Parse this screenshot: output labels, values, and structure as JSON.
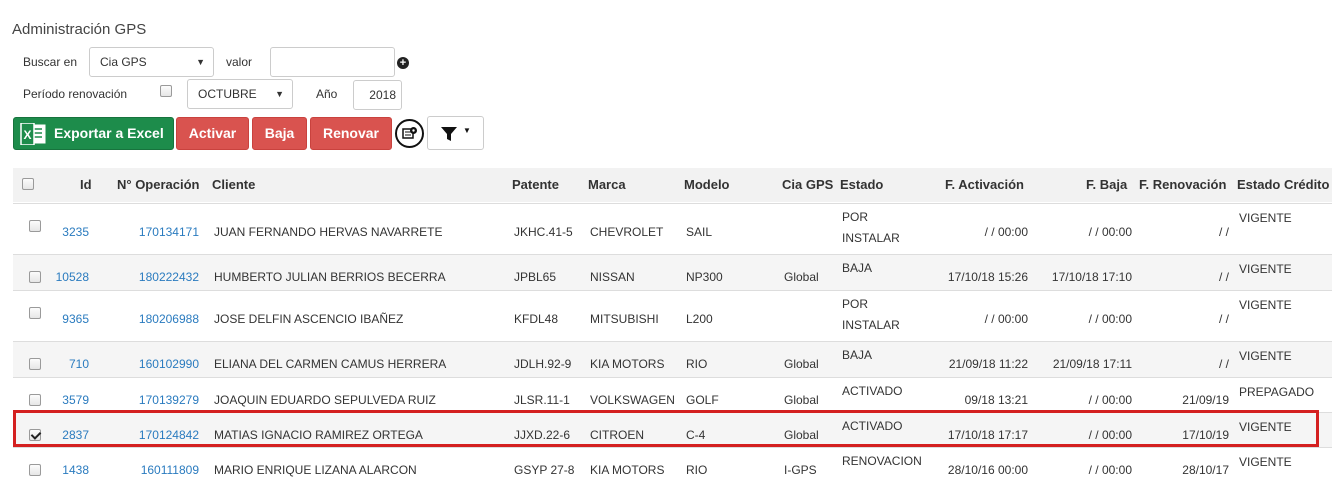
{
  "page": {
    "title": "Administración GPS",
    "search_label": "Buscar en",
    "search_select": "Cia GPS",
    "value_label": "valor",
    "value_input": "",
    "period_label": "Período renovación",
    "month_select": "OCTUBRE",
    "year_label": "Año",
    "year_value": "2018"
  },
  "toolbar": {
    "export_label": "Exportar a Excel",
    "activar_label": "Activar",
    "baja_label": "Baja",
    "renovar_label": "Renovar",
    "icons": [
      "excel-icon",
      "settings-icon",
      "filter-icon",
      "caret-down-icon",
      "plus-circle-icon"
    ]
  },
  "colors": {
    "excel": "#1d8c4b",
    "danger": "#d9534f",
    "link": "#2a7bbf",
    "highlight": "#d42020"
  },
  "table": {
    "headers": {
      "id": "Id",
      "op": "N° Operación",
      "cliente": "Cliente",
      "patente": "Patente",
      "marca": "Marca",
      "modelo": "Modelo",
      "cia": "Cia GPS",
      "estado": "Estado",
      "f_act": "F. Activación",
      "f_baja": "F. Baja",
      "f_ren": "F. Renovación",
      "credito": "Estado Crédito"
    },
    "rows": [
      {
        "id": "3235",
        "op": "170134171",
        "cliente": "JUAN FERNANDO HERVAS NAVARRETE",
        "patente": "JKHC.41-5",
        "marca": "CHEVROLET",
        "modelo": "SAIL",
        "cia": "",
        "estado1": "POR",
        "estado2": "INSTALAR",
        "f_act": " /  / 00:00",
        "f_baja": " /  / 00:00",
        "f_ren": " /  / ",
        "credito": "VIGENTE",
        "checked": false
      },
      {
        "id": "10528",
        "op": "180222432",
        "cliente": "HUMBERTO JULIAN BERRIOS BECERRA",
        "patente": "JPBL65",
        "marca": "NISSAN",
        "modelo": "NP300",
        "cia": "Global",
        "estado1": "BAJA",
        "estado2": "",
        "f_act": "17/10/18 15:26",
        "f_baja": "17/10/18 17:10",
        "f_ren": " /  / ",
        "credito": "VIGENTE",
        "checked": false
      },
      {
        "id": "9365",
        "op": "180206988",
        "cliente": "JOSE DELFIN ASCENCIO IBAÑEZ",
        "patente": "KFDL48",
        "marca": "MITSUBISHI",
        "modelo": "L200",
        "cia": "",
        "estado1": "POR",
        "estado2": "INSTALAR",
        "f_act": " /  / 00:00",
        "f_baja": " /  / 00:00",
        "f_ren": " /  / ",
        "credito": "VIGENTE",
        "checked": false
      },
      {
        "id": "710",
        "op": "160102990",
        "cliente": "ELIANA DEL CARMEN CAMUS HERRERA",
        "patente": "JDLH.92-9",
        "marca": "KIA MOTORS",
        "modelo": "RIO",
        "cia": "Global",
        "estado1": "BAJA",
        "estado2": "",
        "f_act": "21/09/18 11:22",
        "f_baja": "21/09/18 17:11",
        "f_ren": " /  / ",
        "credito": "VIGENTE",
        "checked": false
      },
      {
        "id": "3579",
        "op": "170139279",
        "cliente": "JOAQUIN EDUARDO SEPULVEDA RUIZ",
        "patente": "JLSR.11-1",
        "marca": "VOLKSWAGEN",
        "modelo": "GOLF",
        "cia": "Global",
        "estado1": "ACTIVADO",
        "estado2": "",
        "f_act": "09/18 13:21",
        "f_baja": " /  / 00:00",
        "f_ren": "21/09/19",
        "credito": "PREPAGADO",
        "checked": false
      },
      {
        "id": "2837",
        "op": "170124842",
        "cliente": "MATIAS IGNACIO RAMIREZ ORTEGA",
        "patente": "JJXD.22-6",
        "marca": "CITROEN",
        "modelo": "C-4",
        "cia": "Global",
        "estado1": "ACTIVADO",
        "estado2": "",
        "f_act": "17/10/18 17:17",
        "f_baja": " /  / 00:00",
        "f_ren": "17/10/19",
        "credito": "VIGENTE",
        "checked": true
      },
      {
        "id": "1438",
        "op": "160111809",
        "cliente": "MARIO ENRIQUE LIZANA ALARCON",
        "patente": "GSYP 27-8",
        "marca": "KIA MOTORS",
        "modelo": "RIO",
        "cia": "I-GPS",
        "estado1": "RENOVACION",
        "estado2": "",
        "f_act": "28/10/16 00:00",
        "f_baja": " /  / 00:00",
        "f_ren": "28/10/17",
        "credito": "VIGENTE",
        "checked": false
      }
    ]
  }
}
